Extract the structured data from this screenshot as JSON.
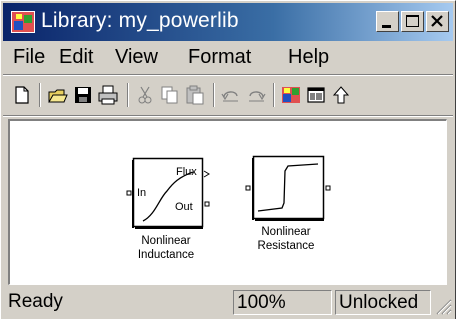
{
  "window": {
    "title": "Library: my_powerlib"
  },
  "menu": [
    "File",
    "Edit",
    "View",
    "Format",
    "Help"
  ],
  "toolbar": [
    "new-icon",
    "open-icon",
    "save-icon",
    "print-icon",
    "cut-icon",
    "copy-icon",
    "paste-icon",
    "undo-icon",
    "redo-icon",
    "library-browser-icon",
    "model-browser-icon",
    "go-to-parent-icon"
  ],
  "blocks": {
    "inductance": {
      "label_line1": "Nonlinear",
      "label_line2": "Inductance",
      "port_in": "In",
      "port_flux": "Flux",
      "port_out": "Out"
    },
    "resistance": {
      "label_line1": "Nonlinear",
      "label_line2": "Resistance"
    }
  },
  "status": {
    "state": "Ready",
    "zoom": "100%",
    "lock": "Unlocked"
  },
  "colors": {
    "title_bar": "#0a246a",
    "chrome": "#d4d0c8",
    "canvas": "#ffffff"
  }
}
